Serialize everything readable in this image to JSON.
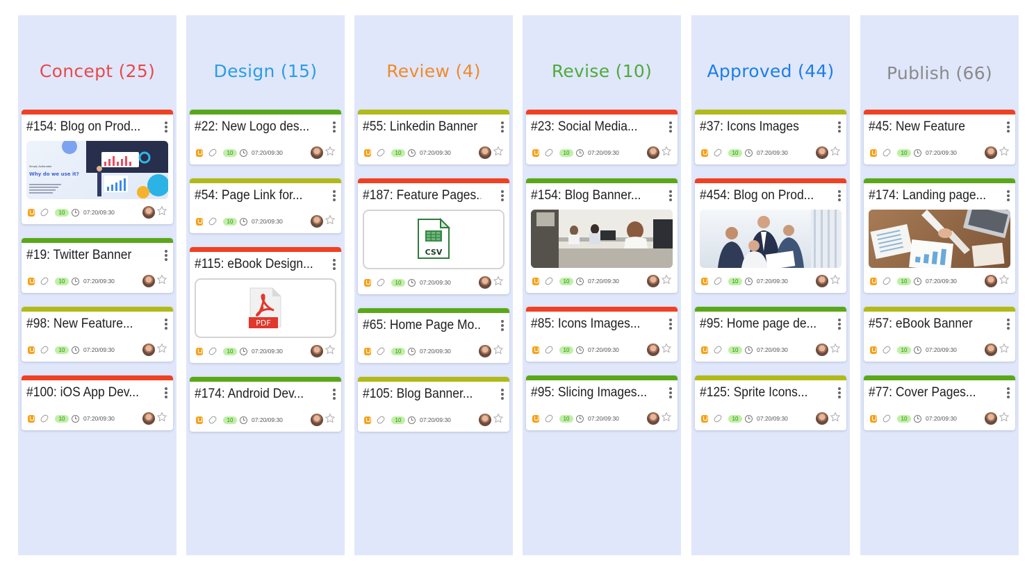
{
  "columns": [
    {
      "title": "Concept (25)",
      "color": "#e84a4a",
      "cards": [
        {
          "title": "#154: Blog on Prod...",
          "bar": "#ef4123",
          "attachment": "image-marketing",
          "count": "10",
          "time": "07:20/09:30",
          "promo": {
            "small": "Simply Actionable",
            "heading": "Why do we use it?"
          }
        },
        {
          "title": "#19: Twitter Banner",
          "bar": "#5aa819",
          "count": "10",
          "time": "07:20/09:30"
        },
        {
          "title": "#98: New Feature...",
          "bar": "#b1ba18",
          "count": "10",
          "time": "07:20/09:30"
        },
        {
          "title": "#100: iOS App Dev...",
          "bar": "#ef4123",
          "count": "10",
          "time": "07:20/09:30"
        }
      ]
    },
    {
      "title": "Design (15)",
      "color": "#2a9de6",
      "cards": [
        {
          "title": "#22: New Logo des...",
          "bar": "#5aa819",
          "count": "10",
          "time": "07:20/09:30"
        },
        {
          "title": "#54: Page Link for...",
          "bar": "#b1ba18",
          "count": "10",
          "time": "07:20/09:30"
        },
        {
          "title": "#115: eBook Design...",
          "bar": "#ef4123",
          "attachment": "file-pdf",
          "file_label": "PDF",
          "count": "10",
          "time": "07:20/09:30"
        },
        {
          "title": "#174: Android Dev...",
          "bar": "#5aa819",
          "count": "10",
          "time": "07:20/09:30"
        }
      ]
    },
    {
      "title": "Review (4)",
      "color": "#f08a28",
      "cards": [
        {
          "title": "#55: Linkedin Banner",
          "bar": "#b1ba18",
          "count": "10",
          "time": "07:20/09:30"
        },
        {
          "title": "#187: Feature Pages...",
          "bar": "#ef4123",
          "attachment": "file-csv",
          "file_label": "CSV",
          "count": "10",
          "time": "07:20/09:30"
        },
        {
          "title": "#65: Home Page Mo...",
          "bar": "#5aa819",
          "count": "10",
          "time": "07:20/09:30"
        },
        {
          "title": "#105: Blog Banner...",
          "bar": "#b1ba18",
          "count": "10",
          "time": "07:20/09:30"
        }
      ]
    },
    {
      "title": "Revise (10)",
      "color": "#4eaa3a",
      "cards": [
        {
          "title": "#23: Social Media...",
          "bar": "#ef4123",
          "count": "10",
          "time": "07:20/09:30"
        },
        {
          "title": "#154: Blog Banner...",
          "bar": "#5aa819",
          "attachment": "image-office",
          "count": "10",
          "time": "07:20/09:30"
        },
        {
          "title": "#85: Icons Images...",
          "bar": "#ef4123",
          "count": "10",
          "time": "07:20/09:30"
        },
        {
          "title": "#95: Slicing Images...",
          "bar": "#5aa819",
          "count": "10",
          "time": "07:20/09:30"
        }
      ]
    },
    {
      "title": "Approved (44)",
      "color": "#1a7ee8",
      "cards": [
        {
          "title": "#37: Icons Images",
          "bar": "#b1ba18",
          "count": "10",
          "time": "07:20/09:30"
        },
        {
          "title": "#454: Blog on Prod...",
          "bar": "#ef4123",
          "attachment": "image-meeting",
          "count": "10",
          "time": "07:20/09:30"
        },
        {
          "title": "#95: Home page de...",
          "bar": "#5aa819",
          "count": "10",
          "time": "07:20/09:30"
        },
        {
          "title": "#125: Sprite Icons...",
          "bar": "#b1ba18",
          "count": "10",
          "time": "07:20/09:30"
        }
      ]
    },
    {
      "title": "Publish (66)",
      "color": "#8a8a8a",
      "cards": [
        {
          "title": "#45: New Feature",
          "bar": "#ef4123",
          "count": "10",
          "time": "07:20/09:30"
        },
        {
          "title": "#174: Landing page...",
          "bar": "#5aa819",
          "attachment": "image-desk",
          "count": "10",
          "time": "07:20/09:30"
        },
        {
          "title": "#57: eBook Banner",
          "bar": "#b1ba18",
          "count": "10",
          "time": "07:20/09:30"
        },
        {
          "title": "#77: Cover Pages...",
          "bar": "#5aa819",
          "count": "10",
          "time": "07:20/09:30"
        }
      ]
    }
  ]
}
